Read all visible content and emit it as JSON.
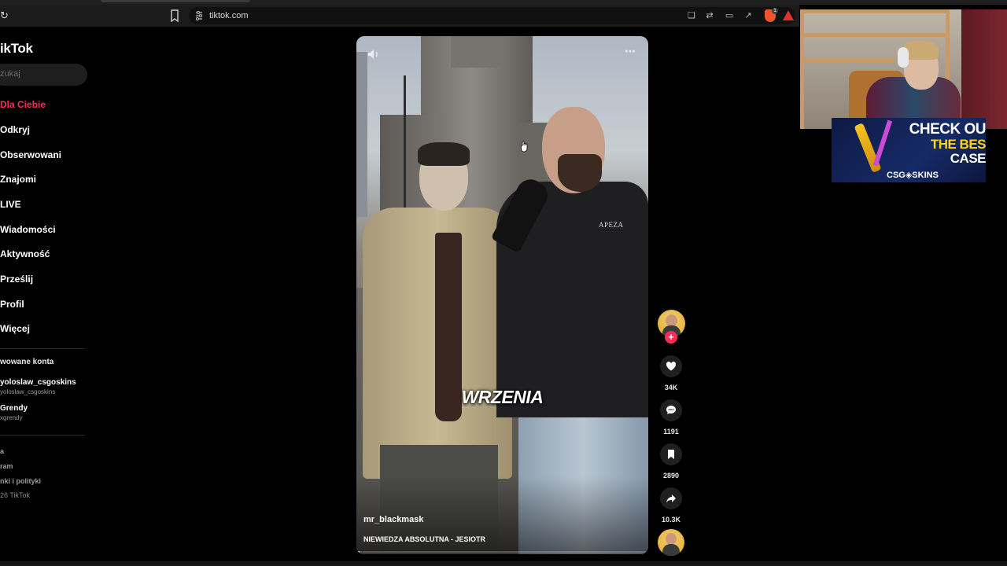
{
  "browser": {
    "url": "tiktok.com",
    "icons": [
      "reload-icon",
      "bookmark-icon",
      "site-info-icon",
      "reader-mode-icon",
      "translate-icon",
      "cast-icon",
      "share-icon",
      "brave-shields-icon",
      "brave-rewards-icon"
    ],
    "shield_badge": "1"
  },
  "sidebar": {
    "logo": "ikTok",
    "search_placeholder": "zukaj",
    "nav": [
      {
        "label": "Dla Ciebie",
        "active": true
      },
      {
        "label": "Odkryj"
      },
      {
        "label": "Obserwowani"
      },
      {
        "label": "Znajomi"
      },
      {
        "label": "LIVE"
      },
      {
        "label": "Wiadomości"
      },
      {
        "label": "Aktywność"
      },
      {
        "label": "Prześlij"
      },
      {
        "label": "Profil"
      },
      {
        "label": "Więcej"
      }
    ],
    "followed_title": "wowane konta",
    "accounts": [
      {
        "name": "yoloslaw_csgoskins",
        "handle": "yoloslaw_csgoskins"
      },
      {
        "name": "Grendy",
        "handle": "xgrendy"
      }
    ],
    "footer": [
      "a",
      "ram",
      "nki i polityki",
      "26 TikTok"
    ],
    "accent": "#fe2c55"
  },
  "video": {
    "overlay_text": "WRZENIA",
    "author": "mr_blackmask",
    "caption": "NIEWIEDZA ABSOLUTNA - JESIOTR",
    "hoodie_text": "APEZA",
    "progress": 0.01,
    "icons": [
      "volume-icon",
      "more-icon"
    ]
  },
  "actions": [
    {
      "icon": "heart-icon",
      "count": "34K"
    },
    {
      "icon": "comment-icon",
      "count": "1191"
    },
    {
      "icon": "bookmark-icon",
      "count": "2890"
    },
    {
      "icon": "share-icon",
      "count": "10.3K"
    }
  ],
  "ad": {
    "line1": "CHECK OU",
    "line2": "THE BES",
    "line3": "CASE",
    "brand": "CSG◈SKINS"
  }
}
